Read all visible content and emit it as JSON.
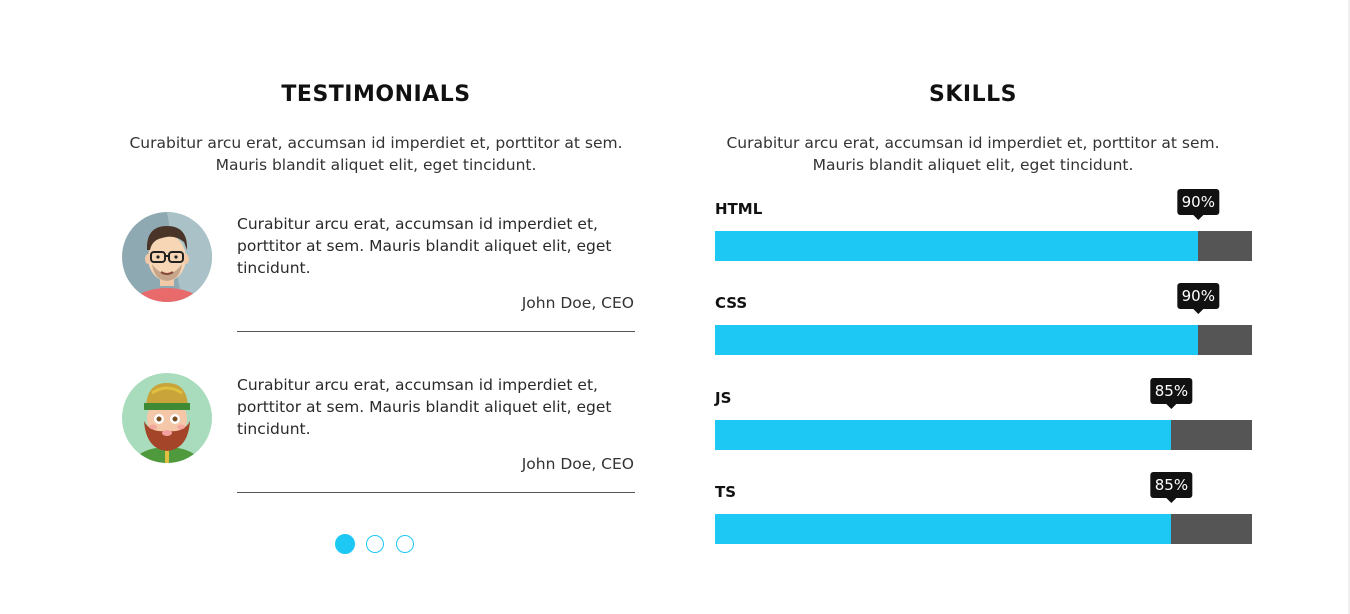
{
  "testimonials": {
    "title": "TESTIMONIALS",
    "intro": "Curabitur arcu erat, accumsan id imperdiet et, porttitor at sem. Mauris blandit aliquet elit, eget tincidunt.",
    "items": [
      {
        "quote": "Curabitur arcu erat, accumsan id imperdiet et, porttitor at sem. Mauris blandit aliquet elit, eget tincidunt.",
        "author": "John Doe, CEO",
        "avatar_icon": "avatar-man-glasses-icon"
      },
      {
        "quote": "Curabitur arcu erat, accumsan id imperdiet et, porttitor at sem. Mauris blandit aliquet elit, eget tincidunt.",
        "author": "John Doe, CEO",
        "avatar_icon": "avatar-bearded-man-icon"
      }
    ],
    "pagination": {
      "count": 3,
      "active": 1
    }
  },
  "skills": {
    "title": "SKILLS",
    "intro": "Curabitur arcu erat, accumsan id imperdiet et, porttitor at sem. Mauris blandit aliquet elit, eget tincidunt.",
    "items": [
      {
        "name": "HTML",
        "percent": 90,
        "percent_label": "90%"
      },
      {
        "name": "CSS",
        "percent": 90,
        "percent_label": "90%"
      },
      {
        "name": "JS",
        "percent": 85,
        "percent_label": "85%"
      },
      {
        "name": "TS",
        "percent": 85,
        "percent_label": "85%"
      }
    ]
  },
  "colors": {
    "accent": "#1ec8f5",
    "bar_track": "#555555",
    "tooltip_bg": "#111111"
  }
}
